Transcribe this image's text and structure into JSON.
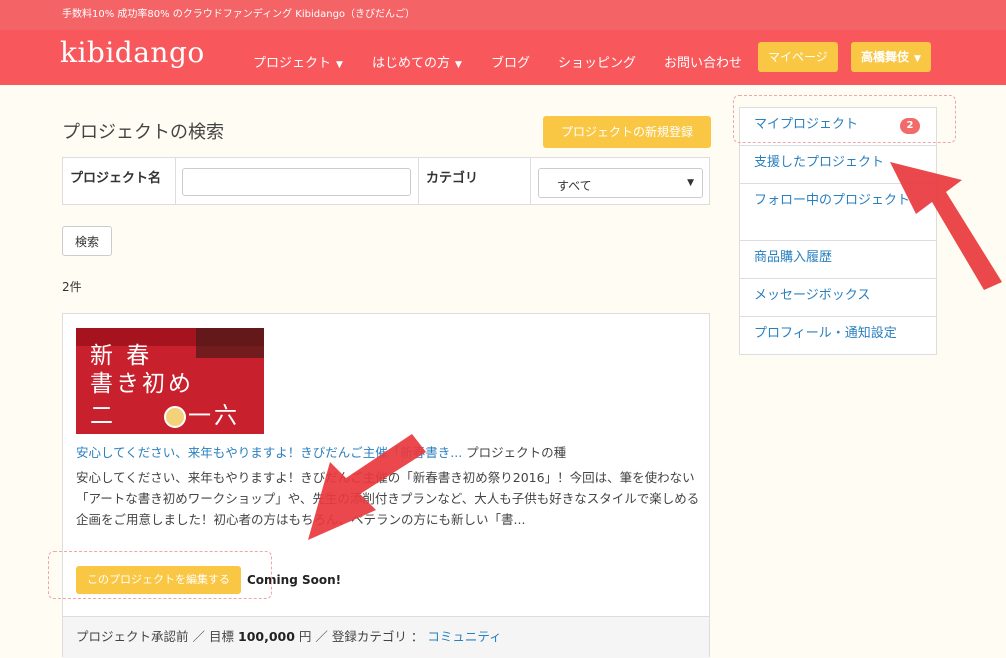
{
  "top_strip": {
    "text": "手数料10% 成功率80% のクラウドファンディング Kibidango（きびだんご）"
  },
  "header": {
    "logo": "kibidango",
    "nav": [
      {
        "label": "プロジェクト",
        "caret": "▼"
      },
      {
        "label": "はじめての方",
        "caret": "▼"
      },
      {
        "label": "ブログ"
      },
      {
        "label": "ショッピング"
      },
      {
        "label": "お問い合わせ"
      }
    ],
    "mypage": "マイページ",
    "user": "高橋舞伎",
    "user_caret": "▼"
  },
  "search": {
    "title": "プロジェクトの検索",
    "new_project": "プロジェクトの新規登録",
    "name_label": "プロジェクト名",
    "name_value": "",
    "category_label": "カテゴリ",
    "category_value": "すべて",
    "select_arrow": "▼",
    "button": "検索",
    "count": "2件"
  },
  "card": {
    "thumb_lines": [
      "新 春",
      "書き初め",
      "二",
      "一六"
    ],
    "title": "安心してください、来年もやりますよ！きびだんご主催「新春書き...",
    "tag": "プロジェクトの種",
    "description": "安心してください、来年もやりますよ！きびだんご主催の「新春書き初め祭り2016」！今回は、筆を使わない「アートな書き初めワークショップ」や、先生の添削付きプランなど、大人も子供も好きなスタイルで楽しめる企画をご用意しました！初心者の方はもちろん、ベテランの方にも新しい「書...",
    "edit_button": "このプロジェクトを編集する",
    "status": "Coming Soon!",
    "footer": {
      "approval": "プロジェクト承認前",
      "sep": "／",
      "goal_label": "目標",
      "goal_value": "100,000",
      "goal_unit": "円",
      "cat_label": "登録カテゴリ",
      "colon": "：",
      "cat_value": "コミュニティ"
    }
  },
  "sidebar": {
    "items": [
      {
        "label": "マイプロジェクト",
        "badge": "2"
      },
      {
        "label": "支援したプロジェクト"
      },
      {
        "label": "フォロー中のプロジェクト"
      },
      {
        "label": "商品購入履歴"
      },
      {
        "label": "メッセージボックス"
      },
      {
        "label": "プロフィール・通知設定"
      }
    ]
  },
  "colors": {
    "brand": "#f8585c",
    "accent": "#f9c744",
    "link": "#2a7fbf",
    "annotation_arrow": "#e8383d"
  }
}
